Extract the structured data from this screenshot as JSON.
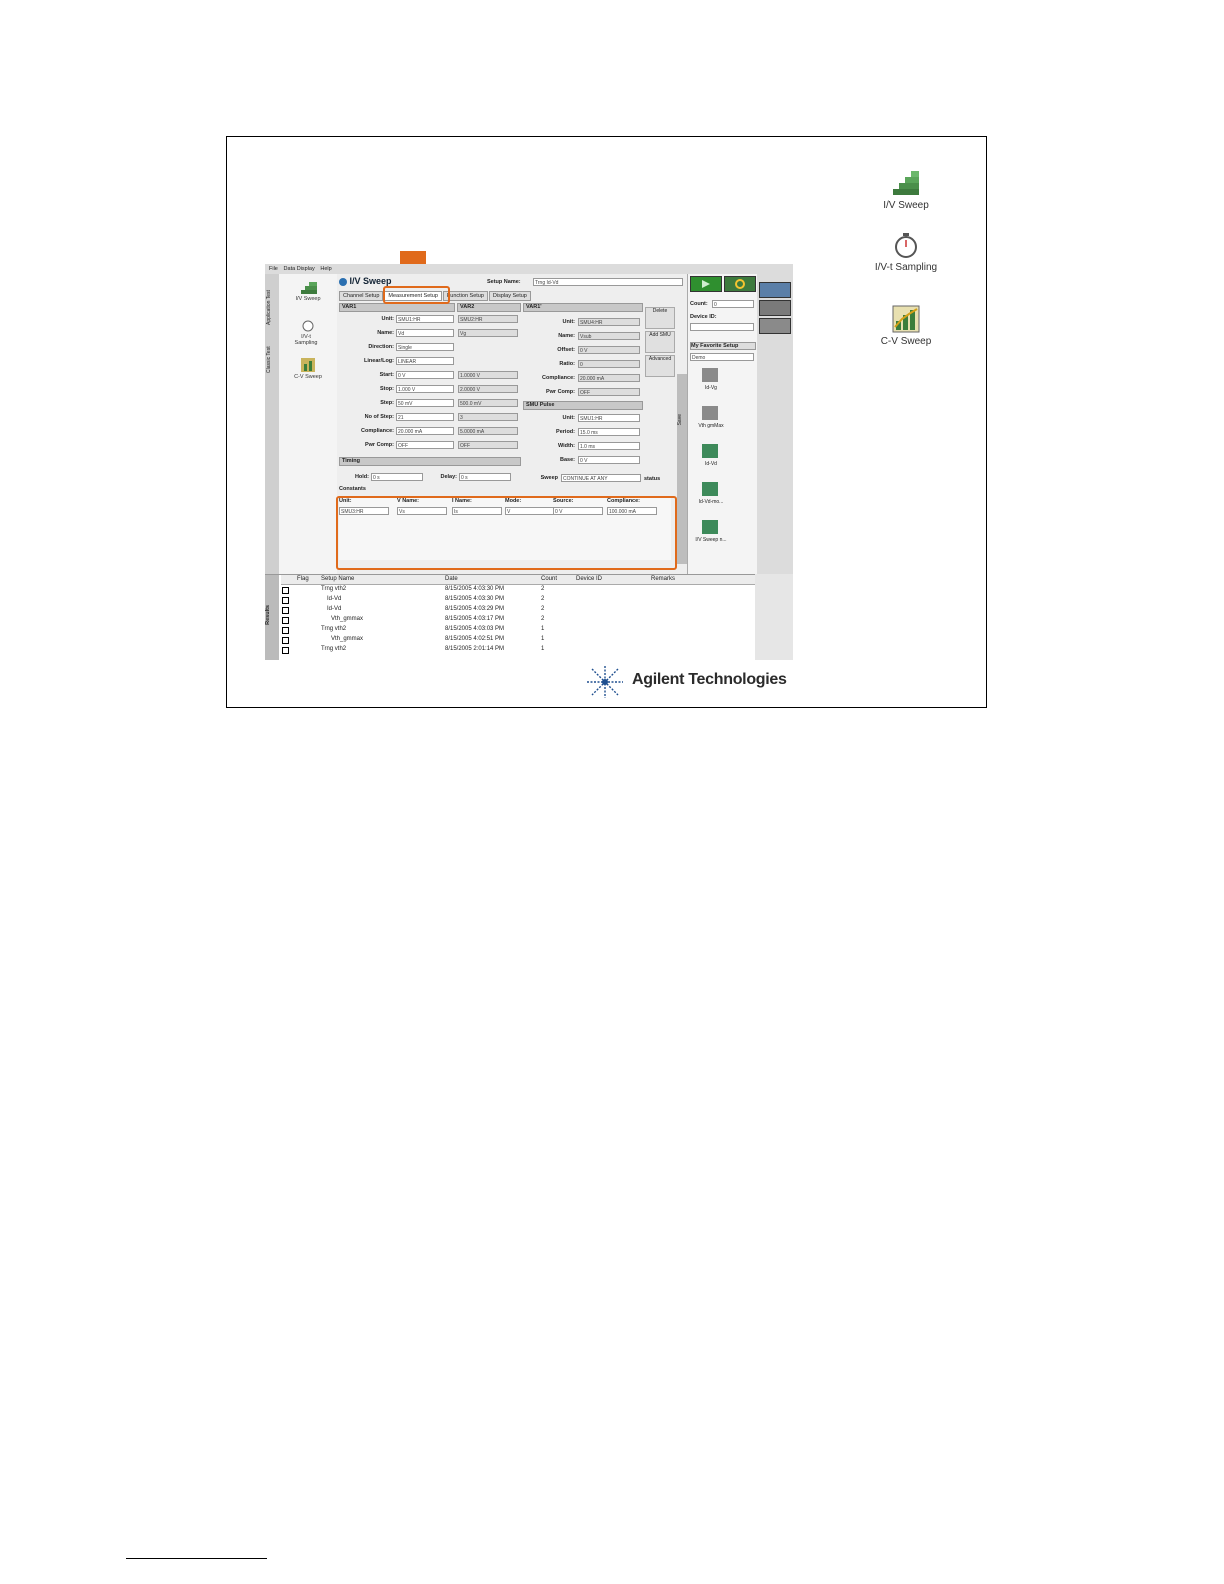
{
  "menu": [
    "File",
    "Data Display",
    "Help"
  ],
  "vertical_tabs": [
    "Application Test",
    "Classic Test"
  ],
  "results_tab": "Results",
  "left_pane": [
    {
      "label": "I/V Sweep",
      "icon": "staircase-icon"
    },
    {
      "label": "I/V-t Sampling",
      "icon": "stopwatch-icon"
    },
    {
      "label": "C-V Sweep",
      "icon": "cv-chart-icon"
    }
  ],
  "main": {
    "title": "I/V Sweep",
    "setup_name_label": "Setup Name:",
    "setup_name_value": "Trng Id-Vd",
    "tabs": [
      "Channel Setup",
      "Measurement Setup",
      "Function Setup",
      "Display Setup"
    ],
    "active_tab": "Measurement Setup",
    "var1": {
      "header": "VAR1",
      "labels": [
        "Unit:",
        "Name:",
        "Direction:",
        "Linear/Log:",
        "Start:",
        "Stop:",
        "Step:",
        "No of Step:",
        "Compliance:",
        "Pwr Comp:"
      ],
      "values": [
        "SMU1:HR",
        "Vd",
        "Single",
        "LINEAR",
        "0 V",
        "1.000 V",
        "50 mV",
        "21",
        "20.000 mA",
        "OFF"
      ]
    },
    "var2": {
      "header": "VAR2",
      "values": [
        "SMU2:HR",
        "Vg",
        "",
        "",
        "1.0000 V",
        "2.0000 V",
        "500.0 mV",
        "3",
        "5.0000 mA",
        "OFF"
      ]
    },
    "var1p": {
      "header": "VAR1'",
      "labels": [
        "Unit:",
        "Name:",
        "Offset:",
        "Ratio:",
        "Compliance:",
        "Pwr Comp:"
      ],
      "values": [
        "SMU4:HR",
        "Vsub",
        "0 V",
        "0",
        "20.000 mA",
        "OFF"
      ]
    },
    "smu_pulse": {
      "header": "SMU Pulse",
      "labels": [
        "Unit:",
        "Period:",
        "Width:",
        "Base:"
      ],
      "values": [
        "SMU1:HR",
        "15.0 ms",
        "1.0 ms",
        "0 V"
      ]
    },
    "side_buttons": [
      "Delete",
      "Add SMU",
      "Advanced"
    ],
    "save_label": "Save",
    "timing": {
      "header": "Timing",
      "hold_label": "Hold:",
      "hold_value": "0 s",
      "delay_label": "Delay:",
      "delay_value": "0 s"
    },
    "sweep": {
      "label": "Sweep",
      "value": "CONTINUE AT ANY",
      "status": "status"
    },
    "constants": {
      "header": "Constants",
      "columns": [
        "Unit:",
        "V Name:",
        "I Name:",
        "Mode:",
        "Source:",
        "Compliance:"
      ],
      "row": [
        "SMU3:HR",
        "Vs",
        "Is",
        "V",
        "0 V",
        "100.000 mA"
      ]
    }
  },
  "right_pane": {
    "count_label": "Count:",
    "count_value": "0",
    "device_id_label": "Device ID:",
    "favorites_label": "My Favorite Setup",
    "favorites_value": "Demo",
    "items": [
      "Id-Vg",
      "Vth gmMax",
      "Id-Vd",
      "Id-Vd-mo...",
      "I/V Sweep n..."
    ]
  },
  "results": {
    "columns": [
      "Flag",
      "Setup Name",
      "Date",
      "Count",
      "Device ID",
      "Remarks"
    ],
    "rows": [
      {
        "name": "Trng vth2",
        "date": "8/15/2005 4:03:30 PM",
        "count": "2"
      },
      {
        "name": "Id-Vd",
        "date": "8/15/2005 4:03:30 PM",
        "count": "2"
      },
      {
        "name": "Id-Vd",
        "date": "8/15/2005 4:03:29 PM",
        "count": "2"
      },
      {
        "name": "Vth_gmmax",
        "date": "8/15/2005 4:03:17 PM",
        "count": "2"
      },
      {
        "name": "Trng vth2",
        "date": "8/15/2005 4:03:03 PM",
        "count": "1"
      },
      {
        "name": "Vth_gmmax",
        "date": "8/15/2005 4:02:51 PM",
        "count": "1"
      },
      {
        "name": "Trng vth2",
        "date": "8/15/2005 2:01:14 PM",
        "count": "1"
      }
    ]
  },
  "desktop_icons": [
    {
      "label": "I/V Sweep",
      "icon": "staircase-icon"
    },
    {
      "label": "I/V-t Sampling",
      "icon": "stopwatch-icon"
    },
    {
      "label": "C-V Sweep",
      "icon": "cv-chart-icon"
    }
  ],
  "logo": "Agilent Technologies",
  "colors": {
    "highlight": "#e06a1b",
    "run": "#2f8f2f"
  }
}
